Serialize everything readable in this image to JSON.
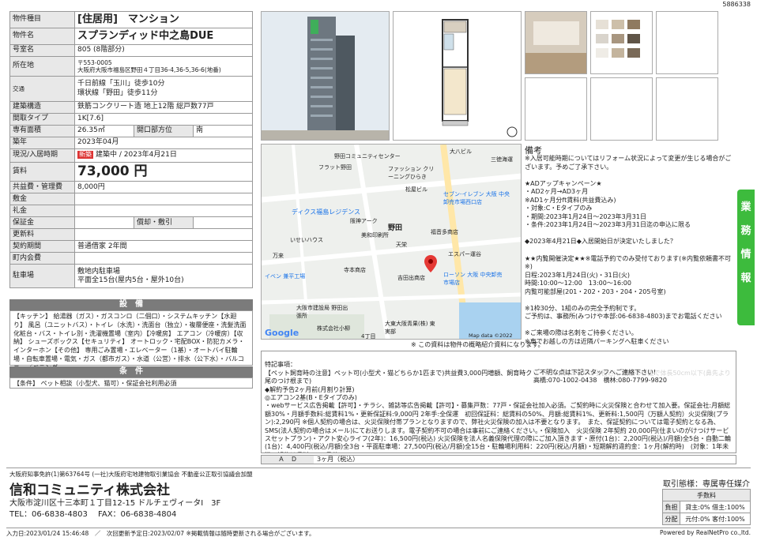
{
  "doc_id": "5886338",
  "spec": {
    "type_label": "物件種目",
    "type_value": "[住居用]　マンション",
    "name_label": "物件名",
    "name_value": "スプランディッド中之島DUE",
    "room_label": "号室名",
    "room_value": "805 (8階部分)",
    "location_label": "所在地",
    "postal": "〒553-0005",
    "address": "大阪府大阪市福島区野田４丁目36-4,36-5,36-6(地番)",
    "transport_label": "交通",
    "transport_1": "千日前線「玉川」徒歩10分",
    "transport_2": "環状線「野田」徒歩11分",
    "structure_label": "建築構造",
    "structure_value": "鉄筋コンクリート造 地上12階 総戸数77戸",
    "layout_label": "間取タイプ",
    "layout_value": "1K[7.6]",
    "area_label": "専有面積",
    "area_value": "26.35㎡",
    "window_label": "開口部方位",
    "window_value": "南",
    "built_label": "築年",
    "built_value": "2023年04月",
    "status_label": "現況/入居時期",
    "status_badge": "新築",
    "status_value": "建築中 / 2023年4月21日",
    "rent_label": "賃料",
    "rent_value": "73,000 円",
    "fee_label": "共益費・管理費",
    "fee_value": "8,000円",
    "deposit_label": "敷金",
    "deposit_value": "",
    "key_label": "礼金",
    "key_value": "",
    "guarantee_label": "保証金",
    "guarantee_value": "",
    "amort_label": "償却・敷引",
    "amort_value": "",
    "renewal_label": "更新料",
    "renewal_value": "",
    "contract_label": "契約期間",
    "contract_value": "普通借家 2年間",
    "assoc_label": "町内会費",
    "assoc_value": "",
    "parking_label": "駐車場",
    "parking_1": "敷地内駐車場",
    "parking_2": "平面全15台(屋内5台・屋外10台)"
  },
  "equipment": {
    "heading": "設　備",
    "text": "【キッチン】 給湯器（ガス）・ガスコンロ（二個口）・システムキッチン【水廻り】 風呂（ユニットバス）・トイレ（水洗）・洗面台（独立）・複層便座・洗髪洗面化粧台・バス・トイレ別・洗濯機置場（室内）【冷暖房】 エアコン（冷暖房）【収納】 シューズボックス【セキュリティ】 オートロック・宅配BOX・防犯カメラ・インターホン【その他】 専用ごみ置場・エレベーター（1基）・オートバイ駐輪場・自転車置場・電気・ガス（都市ガス）・水道（公営）・排水（公下水）・バルコニー／ベランダ"
  },
  "conditions": {
    "heading": "条　件",
    "text": "【条件】 ペット相談（小型犬、猫可）・保証会社利用必須"
  },
  "map": {
    "labels": [
      "野田コミュニティセンター",
      "大八ビル",
      "三徳海運",
      "フラット野田",
      "ファッション クリーニングひらき",
      "松屋ビル",
      "セブン-イレブン 大阪 中央卸売市場西口店",
      "ディクス福島レジデンス",
      "阪神アーク",
      "美和印刷所",
      "野田",
      "福音多商店",
      "いせいハウス",
      "天栄",
      "エスパー運谷",
      "万来",
      "寺本商店",
      "吉田出商店",
      "ローソン 大阪 中央卸売市場店",
      "イベン 兼平工場",
      "大阪市建設局 野田出張所",
      "株式会社小柳",
      "大東大阪青果(株) 東実部",
      "4丁目"
    ],
    "google": "Google",
    "copyright": "Map data ©2022"
  },
  "remarks": {
    "title": "備考",
    "text": "※入居可能時期についてはリフォーム状況によって変更が生じる場合がございます。予めご了承下さい。\n\n★ADアップキャンペーン★\n・AD2ヶ月→AD3ヶ月\n※AD1ヶ月分ft賃料(共益費込み)\n・対象:C・Eタイプのみ\n・期間:2023年1月24日～2023年3月31日\n・条件:2023年1月24日～2023年3月31日迄の申込に限る\n\n◆2023年4月21日◆入居開始日が決定いたしました？\n\n★★内覧開催決定★★※電話予約でのみ受付ております(※内覧依頼書不可※)\n日程:2023年1月24日(火)・31日(火)\n時間:10:00～12:00　13:00～16:00\n内覧可能部屋(201・202・203・204・205号室)\n\n※1枠30分、1組のみの完全予約制です。\nご予約は、事務所(みつけや本部:06-6838-4803)までお電話ください\n\n※ご来場の際は名刺をご持参ください。\n※車でお越しの方は近隣パーキングへ駐車ください\n(路上駐車や、物件土地内への駐車はお止めください。)\n※現地に到着しましたら、担当者の案内があるまで入場はお待ちください\n※間取り図と現況に相違がある場合には現況を優先いたします。"
  },
  "side_tab": [
    "業",
    "務",
    "情",
    "報"
  ],
  "map_note": "※ この資料は物件の概略紹介資料になります。",
  "notes": {
    "text": "特記事項：\n【ペット飼育時の注意】ペット可(小型犬・猫どちらか1匹まで)共益費3,000円増額、飼育時クリーニング費27,500円(税込)、成獣の体重で体長50cm以下(鼻先より尾のつけ根まで)\n◆解約予告2ヶ月前(月割り計算)\n◎エアコン2基(B・Eタイプのみ)\n・webサービス広告掲載【許可】・チラシ、雑誌等広告掲載【許可】・募集戸数：77戸・保証会社加入必須。ご契約時に火災保険と合わせて加入要。保証会社:月額総額30%・月額手数料:総賃料1%・更新保証料:9,000円 2年手:全保運　初回保証料：総賃料の50%、月額:総賃料1%、更新料:1,500円（万額人契約）火災保険(プラン):2,290円 ※個人契約の場合は、火災保険付帯プランとなりますので、弊社火災保険の加入は不要となります。　また、保証契約については電子契約となる為、SMS(法人契約の場合はメール)にてお送りします。電子契約不可の場合は事前にご連絡ください。・保険加入　火災保険 2年契約 20,000円(住まいのがけつけサービスセットプラン)・アクト安心ライフ(2年)：16,500円(税込) 火災保険を法人名義保険代理の際にご加入頂きます・原付(1台)：2,200円(税込)/月額)全5台・自動二輪(1台)：4,400円(税込/月額)全3台・平面駐車場：27,500円(税込/月額)全15台・駐輪場利用料：220円(税込/月額)・短期解約違約金：1ヶ月(解約時)　(対象：1年未満の解約は賃料の1ヶ月分)",
    "overlay": "ご不明な点は下記スタッフへご連絡下さい!\n高橋:070-1002-0438　横林:080-7799-9820"
  },
  "ad": {
    "label": "Ａ　Ｄ",
    "value": "3ヶ月（税込）"
  },
  "company": {
    "license": "大阪府知事免許(1)第63764号 (一社)大阪府宅地建物取引業協会 不動産公正取引協議会加盟",
    "name": "信和コミュニティ株式会社",
    "address": "大阪市淀川区十三本町１丁目12-15 ドルチェヴィータⅠ　3F",
    "tel": "TEL：06-6838-4803　 FAX：06-6838-4804"
  },
  "torihiki": {
    "heading": "取引態様：専属専任媒介",
    "fee_heading": "手数料",
    "row1_label": "負担",
    "row1_value": "貸主:0% 借主:100%",
    "row2_label": "分配",
    "row2_value": "元付:0% 客付:100%"
  },
  "footer": {
    "left": "入力日:2023/01/24 15:46:48　／　次回更新予定日:2023/02/07 ※掲載情報は随時更新される場合がございます。",
    "right": "Powered by RealNetPro co.,ltd."
  }
}
